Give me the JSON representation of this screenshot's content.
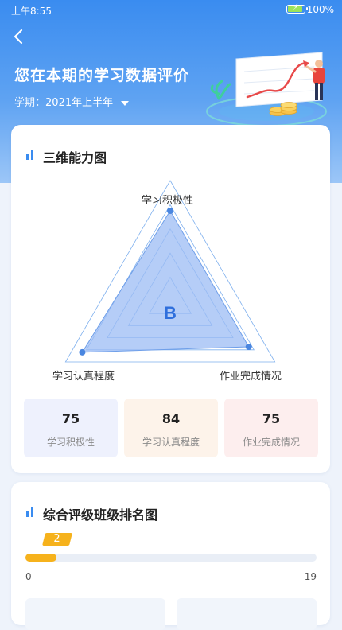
{
  "status_bar": {
    "time": "上午8:55",
    "battery": "100%"
  },
  "header": {
    "title": "您在本期的学习数据评价",
    "term_label": "学期：",
    "term_value": "2021年上半年"
  },
  "ability_card": {
    "title": "三维能力图",
    "grade": "B",
    "axes": [
      "学习积极性",
      "作业完成情况",
      "学习认真程度"
    ],
    "scores": [
      75,
      75,
      84
    ],
    "max": 100,
    "stats": [
      {
        "value": "75",
        "label": "学习积极性"
      },
      {
        "value": "84",
        "label": "学习认真程度"
      },
      {
        "value": "75",
        "label": "作业完成情况"
      }
    ]
  },
  "rank_card": {
    "title": "综合评级班级排名图",
    "rank": 2,
    "min_label": "0",
    "max_label": "19",
    "total": 19
  },
  "colors": {
    "accent": "#3a8cf0",
    "radar_fill": "#9cbcf4",
    "rank": "#f6b21c",
    "stat_bg_1": "#eef1fd",
    "stat_bg_2": "#fdf3ea",
    "stat_bg_3": "#fdeeee"
  }
}
